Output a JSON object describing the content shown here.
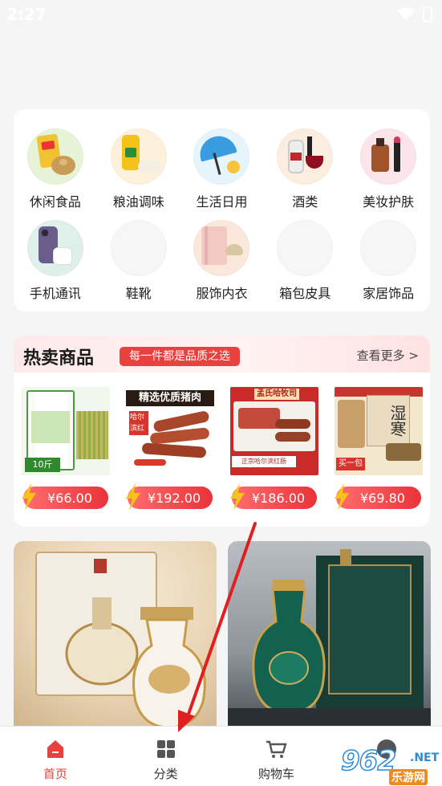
{
  "status_bar": {
    "time": "2:27"
  },
  "categories": [
    {
      "label": "休闲食品",
      "icon": "snack-icon"
    },
    {
      "label": "粮油调味",
      "icon": "oil-icon"
    },
    {
      "label": "生活日用",
      "icon": "umbrella-icon"
    },
    {
      "label": "酒类",
      "icon": "liquor-icon"
    },
    {
      "label": "美妆护肤",
      "icon": "cosmetics-icon"
    },
    {
      "label": "手机通讯",
      "icon": "phone-icon"
    },
    {
      "label": "鞋靴",
      "icon": "shoes-icon"
    },
    {
      "label": "服饰内衣",
      "icon": "clothing-icon"
    },
    {
      "label": "箱包皮具",
      "icon": "luggage-icon"
    },
    {
      "label": "家居饰品",
      "icon": "home-decor-icon"
    }
  ],
  "hot": {
    "title": "热卖商品",
    "badge": "每一件都是品质之选",
    "more": "查看更多 >"
  },
  "products": [
    {
      "price": "¥66.00",
      "img_text": "10斤",
      "icon": "rice-product-image"
    },
    {
      "price": "¥192.00",
      "img_text": "精选优质猪肉",
      "img_sub": "哈尔滨红肠",
      "icon": "sausage-product-image"
    },
    {
      "price": "¥186.00",
      "img_text": "孟氏哈牧司",
      "img_sub": "正宗哈尔滨红肠",
      "icon": "red-sausage-product-image"
    },
    {
      "price": "¥69.80",
      "img_text": "湿寒",
      "img_sub": "买一包",
      "icon": "herbal-pack-product-image"
    }
  ],
  "nav": [
    {
      "label": "首页",
      "icon": "home-icon",
      "active": true
    },
    {
      "label": "分类",
      "icon": "category-icon",
      "active": false
    },
    {
      "label": "购物车",
      "icon": "cart-icon",
      "active": false
    },
    {
      "label": "",
      "icon": "profile-icon",
      "active": false
    }
  ],
  "watermark": {
    "number": "962",
    "net": ".NET",
    "sub": "乐游网"
  },
  "colors": {
    "accent": "#e8413e",
    "arrow": "#e02020"
  }
}
